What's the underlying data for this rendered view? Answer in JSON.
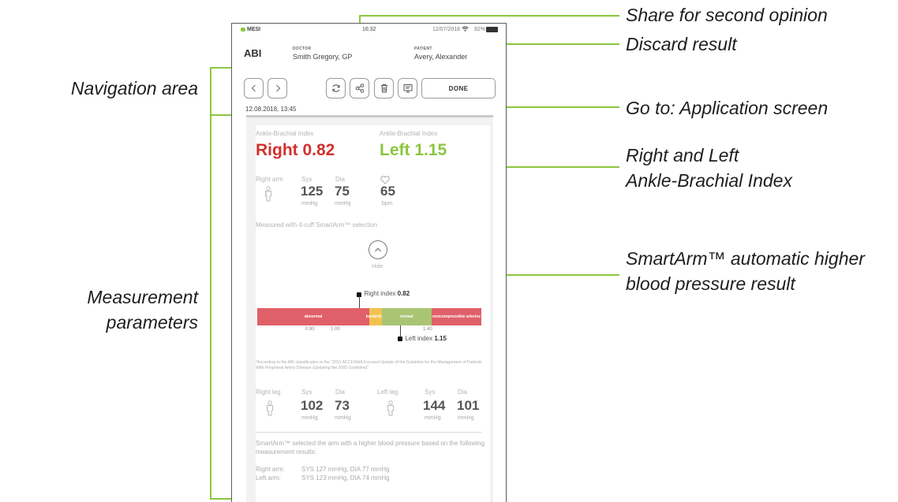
{
  "callouts": {
    "share": "Share for second opinion",
    "discard": "Discard result",
    "navigation": "Navigation area",
    "goto": "Go to: Application screen",
    "abi_line1": "Right and Left",
    "abi_line2": "Ankle-Brachial Index",
    "smartarm_line1": "SmartArm™ automatic higher",
    "smartarm_line2": "blood pressure result",
    "params_line1": "Measurement",
    "params_line2": "parameters"
  },
  "status_bar": {
    "brand": "MESI",
    "time": "16:32",
    "date": "12/07/2018",
    "battery": "92%"
  },
  "header": {
    "app_title": "ABI",
    "doctor_caption": "DOCTOR",
    "doctor_name": "Smith Gregory, GP",
    "patient_caption": "PATIENT",
    "patient_name": "Avery, Alexander"
  },
  "toolbar": {
    "done_label": "DONE"
  },
  "measurement": {
    "datetime": "12.08.2018, 13:45",
    "abi_caption": "Ankle-Brachial Index",
    "right_index_text": "Right 0.82",
    "left_index_text": "Left 1.15",
    "right_color": "#d0312d",
    "left_color": "#8cc63f",
    "arm": {
      "label": "Right arm",
      "sys_caption": "Sys",
      "dia_caption": "Dia",
      "sys": "125",
      "dia": "75",
      "pulse": "65",
      "unit": "mmHg",
      "pulse_unit": "bpm"
    },
    "measured_with": "Measured with 4-cuff SmartArm™ selection",
    "hide_label": "Hide",
    "scale": {
      "right_marker_prefix": "Right index ",
      "right_marker_value": "0.82",
      "left_marker_prefix": "Left index ",
      "left_marker_value": "1.15",
      "segments": [
        {
          "label": "abnormal",
          "color": "#e0606a",
          "from": 0.0,
          "to": 0.9
        },
        {
          "label": "borderline",
          "color": "#f2c24f",
          "from": 0.9,
          "to": 1.0
        },
        {
          "label": "normal",
          "color": "#a9c574",
          "from": 1.0,
          "to": 1.4
        },
        {
          "label": "noncompressible arteries",
          "color": "#e0606a",
          "from": 1.4,
          "to": 1.8
        }
      ],
      "range": [
        0.0,
        1.8
      ],
      "right_value": 0.82,
      "left_value": 1.15,
      "ticks": [
        "0.90",
        "1.00",
        "1.40"
      ]
    },
    "footnote": "*According to the ABI classification in the \"2011 ACCF/AHA Focused Update of the Guideline for the Management of Patients With Peripheral Artery Disease (Updating the 2005 Guideline)\"",
    "legs": {
      "right_label": "Right leg",
      "left_label": "Left leg",
      "sys_caption": "Sys",
      "dia_caption": "Dia",
      "right_sys": "102",
      "right_dia": "73",
      "left_sys": "144",
      "left_dia": "101",
      "unit": "mmHg"
    },
    "smartarm_note": "SmartArm™ selected the arm with a higher blood pressure based on the following measurement results:",
    "right_arm_label": "Right arm:",
    "right_arm_value": "SYS 127 mmHg, DIA 77 mmHg",
    "left_arm_label": "Left arm:",
    "left_arm_value": "SYS 123 mmHg, DIA 74 mmHg"
  },
  "icons": {
    "back": "chevron-left-icon",
    "forward": "chevron-right-icon",
    "refresh": "refresh-icon",
    "share": "share-icon",
    "trash": "trash-icon",
    "report": "report-icon",
    "heart": "heart-icon",
    "person": "person-icon",
    "chevron_up": "chevron-up-icon"
  },
  "accent_color": "#8cc63f"
}
